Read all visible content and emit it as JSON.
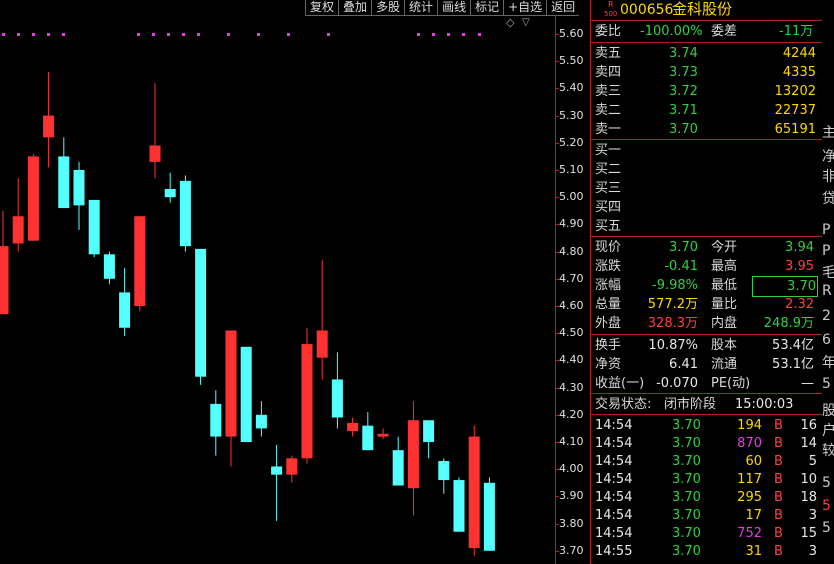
{
  "toolbar": [
    "复权",
    "叠加",
    "多股",
    "统计",
    "画线",
    "标记",
    "+自选",
    "返回"
  ],
  "chart_controls": {
    "diamond": "◇",
    "triangle": "▽"
  },
  "y_axis": {
    "ticks": [
      "5.60",
      "5.50",
      "5.40",
      "5.30",
      "5.20",
      "5.10",
      "5.00",
      "4.90",
      "4.80",
      "4.70",
      "4.60",
      "4.50",
      "4.40",
      "4.30",
      "4.20",
      "4.10",
      "4.00",
      "3.90",
      "3.80",
      "3.70"
    ]
  },
  "chart_data": {
    "type": "candlestick",
    "ylim": [
      3.65,
      5.65
    ],
    "up_color": "#ff3232",
    "down_color": "#54ffff",
    "candles": [
      {
        "o": 4.57,
        "h": 4.95,
        "l": 4.57,
        "c": 4.82
      },
      {
        "o": 4.83,
        "h": 5.07,
        "l": 4.8,
        "c": 4.93
      },
      {
        "o": 4.84,
        "h": 5.16,
        "l": 4.84,
        "c": 5.15
      },
      {
        "o": 5.22,
        "h": 5.46,
        "l": 5.11,
        "c": 5.3
      },
      {
        "o": 5.15,
        "h": 5.22,
        "l": 4.98,
        "c": 4.96
      },
      {
        "o": 5.1,
        "h": 5.13,
        "l": 4.88,
        "c": 4.97
      },
      {
        "o": 4.99,
        "h": 4.99,
        "l": 4.78,
        "c": 4.79
      },
      {
        "o": 4.79,
        "h": 4.8,
        "l": 4.68,
        "c": 4.7
      },
      {
        "o": 4.65,
        "h": 4.74,
        "l": 4.49,
        "c": 4.52
      },
      {
        "o": 4.6,
        "h": 4.93,
        "l": 4.58,
        "c": 4.93
      },
      {
        "o": 5.13,
        "h": 5.42,
        "l": 5.07,
        "c": 5.19
      },
      {
        "o": 5.03,
        "h": 5.09,
        "l": 4.98,
        "c": 5.0
      },
      {
        "o": 5.06,
        "h": 5.08,
        "l": 4.8,
        "c": 4.82
      },
      {
        "o": 4.81,
        "h": 4.81,
        "l": 4.31,
        "c": 4.34
      },
      {
        "o": 4.24,
        "h": 4.29,
        "l": 4.05,
        "c": 4.12
      },
      {
        "o": 4.12,
        "h": 4.5,
        "l": 4.01,
        "c": 4.51
      },
      {
        "o": 4.45,
        "h": 4.45,
        "l": 4.1,
        "c": 4.1
      },
      {
        "o": 4.2,
        "h": 4.25,
        "l": 4.12,
        "c": 4.15
      },
      {
        "o": 4.01,
        "h": 4.09,
        "l": 3.81,
        "c": 3.98
      },
      {
        "o": 3.98,
        "h": 4.05,
        "l": 3.95,
        "c": 4.04
      },
      {
        "o": 4.04,
        "h": 4.52,
        "l": 4.02,
        "c": 4.46
      },
      {
        "o": 4.41,
        "h": 4.77,
        "l": 4.33,
        "c": 4.51
      },
      {
        "o": 4.33,
        "h": 4.43,
        "l": 4.15,
        "c": 4.19
      },
      {
        "o": 4.14,
        "h": 4.19,
        "l": 4.12,
        "c": 4.17
      },
      {
        "o": 4.16,
        "h": 4.21,
        "l": 4.07,
        "c": 4.07
      },
      {
        "o": 4.12,
        "h": 4.15,
        "l": 4.11,
        "c": 4.13
      },
      {
        "o": 4.07,
        "h": 4.12,
        "l": 3.97,
        "c": 3.94
      },
      {
        "o": 3.93,
        "h": 4.25,
        "l": 3.83,
        "c": 4.18
      },
      {
        "o": 4.18,
        "h": 4.18,
        "l": 4.04,
        "c": 4.1
      },
      {
        "o": 4.03,
        "h": 4.04,
        "l": 3.91,
        "c": 3.96
      },
      {
        "o": 3.96,
        "h": 3.97,
        "l": 3.77,
        "c": 3.77
      },
      {
        "o": 3.71,
        "h": 4.16,
        "l": 3.68,
        "c": 4.12
      },
      {
        "o": 3.95,
        "h": 3.97,
        "l": 3.7,
        "c": 3.7
      }
    ]
  },
  "dots": {
    "color": "#e040e0",
    "count": 19
  },
  "header": {
    "badge_top": "R",
    "badge_bottom": "500",
    "code": "000656",
    "name": "金科股份"
  },
  "weibi": {
    "label": "委比",
    "value": "-100.00%",
    "label2": "委差",
    "value2": "-11万"
  },
  "asks": [
    {
      "label": "卖五",
      "price": "3.74",
      "vol": "4244"
    },
    {
      "label": "卖四",
      "price": "3.73",
      "vol": "4335"
    },
    {
      "label": "卖三",
      "price": "3.72",
      "vol": "13202"
    },
    {
      "label": "卖二",
      "price": "3.71",
      "vol": "22737"
    },
    {
      "label": "卖一",
      "price": "3.70",
      "vol": "65191"
    }
  ],
  "bids": [
    {
      "label": "买一"
    },
    {
      "label": "买二"
    },
    {
      "label": "买三"
    },
    {
      "label": "买四"
    },
    {
      "label": "买五"
    }
  ],
  "quote": [
    {
      "l1": "现价",
      "v1": "3.70",
      "l2": "今开",
      "v2": "3.94"
    },
    {
      "l1": "涨跌",
      "v1": "-0.41",
      "l2": "最高",
      "v2": "3.95"
    },
    {
      "l1": "涨幅",
      "v1": "-9.98%",
      "l2": "最低",
      "v2": "3.70"
    },
    {
      "l1": "总量",
      "v1": "577.2万",
      "l2": "量比",
      "v2": "2.32"
    },
    {
      "l1": "外盘",
      "v1": "328.3万",
      "l2": "内盘",
      "v2": "248.9万"
    }
  ],
  "stats": [
    {
      "l1": "换手",
      "v1": "10.87%",
      "l2": "股本",
      "v2": "53.4亿"
    },
    {
      "l1": "净资",
      "v1": "6.41",
      "l2": "流通",
      "v2": "53.1亿"
    },
    {
      "l1": "收益(一)",
      "v1": "-0.070",
      "l2": "PE(动)",
      "v2": "—"
    }
  ],
  "status": {
    "label": "交易状态:",
    "value": "闭市阶段",
    "time": "15:00:03"
  },
  "ticks": [
    {
      "time": "14:54",
      "price": "3.70",
      "vol": "194",
      "side": "B",
      "n": "16"
    },
    {
      "time": "14:54",
      "price": "3.70",
      "vol": "870",
      "side": "B",
      "n": "14"
    },
    {
      "time": "14:54",
      "price": "3.70",
      "vol": "60",
      "side": "B",
      "n": "5"
    },
    {
      "time": "14:54",
      "price": "3.70",
      "vol": "117",
      "side": "B",
      "n": "10"
    },
    {
      "time": "14:54",
      "price": "3.70",
      "vol": "295",
      "side": "B",
      "n": "18"
    },
    {
      "time": "14:54",
      "price": "3.70",
      "vol": "17",
      "side": "B",
      "n": "3"
    },
    {
      "time": "14:54",
      "price": "3.70",
      "vol": "752",
      "side": "B",
      "n": "15"
    },
    {
      "time": "14:55",
      "price": "3.70",
      "vol": "31",
      "side": "B",
      "n": "3"
    }
  ],
  "right_edge": [
    "主",
    "净",
    "非",
    "贷",
    "P",
    "P",
    "毛",
    "R",
    "2",
    "6",
    "年",
    "5",
    "股",
    "户",
    "较",
    "5",
    "5",
    "5"
  ]
}
